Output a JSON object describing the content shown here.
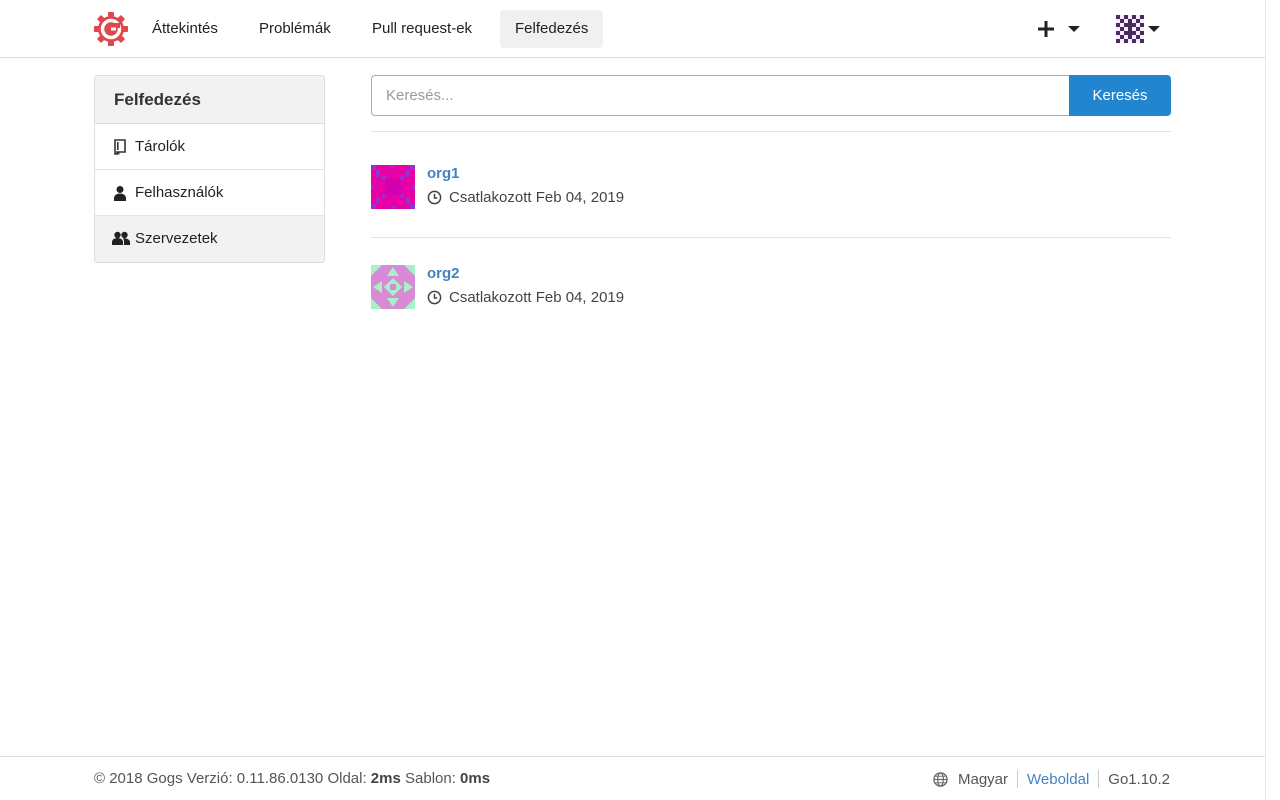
{
  "header": {
    "logo_icon": "gogs-logo-icon",
    "nav": [
      {
        "label": "Áttekintés",
        "active": false
      },
      {
        "label": "Problémák",
        "active": false
      },
      {
        "label": "Pull request-ek",
        "active": false
      },
      {
        "label": "Felfedezés",
        "active": true
      }
    ],
    "create_menu_icon": "plus-icon",
    "user_menu_icon": "user-avatar"
  },
  "sidebar": {
    "title": "Felfedezés",
    "items": [
      {
        "label": "Tárolók",
        "icon": "repo-icon",
        "active": false
      },
      {
        "label": "Felhasználók",
        "icon": "person-icon",
        "active": false
      },
      {
        "label": "Szervezetek",
        "icon": "organization-icon",
        "active": true
      }
    ]
  },
  "search": {
    "placeholder": "Keresés...",
    "value": "",
    "button_label": "Keresés"
  },
  "orgs": [
    {
      "name": "org1",
      "joined": "Csatlakozott Feb 04, 2019",
      "avatar_colors": [
        "#e600a5",
        "#9b2fd0"
      ]
    },
    {
      "name": "org2",
      "joined": "Csatlakozott Feb 04, 2019",
      "avatar_colors": [
        "#d98ad6",
        "#a8f0c6"
      ]
    }
  ],
  "footer": {
    "copyright": "© 2018 Gogs Verzió: 0.11.86.0130 Oldal:",
    "page_time": "2ms",
    "template_label": "Sablon:",
    "template_time": "0ms",
    "language": "Magyar",
    "website_link": "Weboldal",
    "go_version": "Go1.10.2"
  },
  "colors": {
    "accent": "#2185d0",
    "link": "#4183c4"
  }
}
